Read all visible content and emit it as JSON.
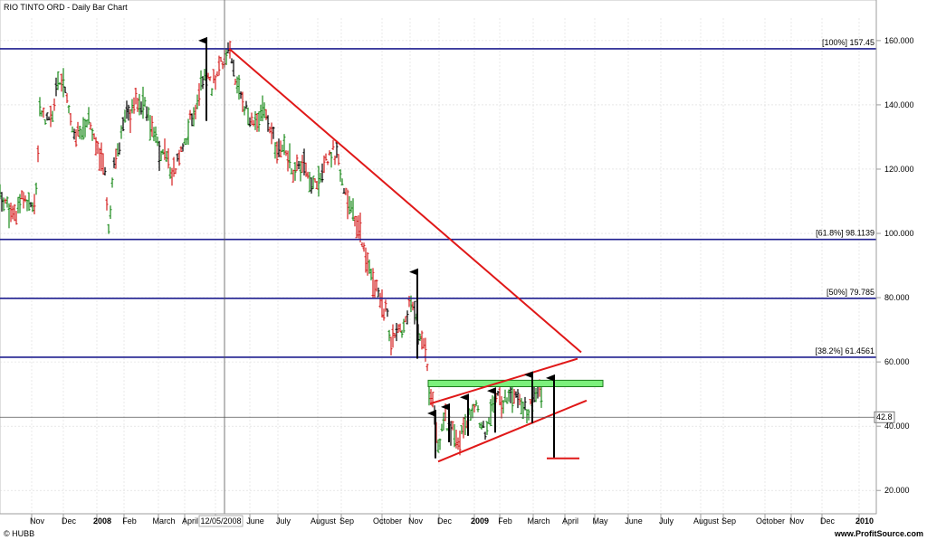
{
  "chart_data": {
    "type": "bar",
    "title": "RIO TINTO ORD - Daily Bar Chart",
    "ylim": [
      15,
      167
    ],
    "y_ticks": [
      20,
      40,
      60,
      80,
      100,
      120,
      140,
      160
    ],
    "y_tick_labels": [
      "20.000",
      "40.000",
      "60.000",
      "80.000",
      "100.000",
      "120.000",
      "140.000",
      "160.000"
    ],
    "x_labels": [
      "Nov",
      "Dec",
      "2008",
      "Feb",
      "March",
      "April",
      "12/05/2008",
      "June",
      "July",
      "August",
      "Sep",
      "October",
      "Nov",
      "Dec",
      "2009",
      "Feb",
      "March",
      "April",
      "May",
      "June",
      "July",
      "August",
      "Sep",
      "October",
      "Nov",
      "Dec",
      "2010"
    ],
    "current_price": "42.8",
    "fib_levels": [
      {
        "label": "[100%] 157.45",
        "value": 157.45
      },
      {
        "label": "[61.8%] 98.1139",
        "value": 98.1139
      },
      {
        "label": "[50%] 79.785",
        "value": 79.785
      },
      {
        "label": "[38.2%] 61.4561",
        "value": 61.4561
      }
    ],
    "price_path": [
      [
        0,
        112
      ],
      [
        8,
        108
      ],
      [
        16,
        106
      ],
      [
        24,
        110
      ],
      [
        34,
        108
      ],
      [
        40,
        112
      ],
      [
        44,
        140
      ],
      [
        50,
        136
      ],
      [
        56,
        134
      ],
      [
        62,
        146
      ],
      [
        70,
        148
      ],
      [
        80,
        132
      ],
      [
        88,
        130
      ],
      [
        96,
        136
      ],
      [
        104,
        130
      ],
      [
        110,
        124
      ],
      [
        116,
        118
      ],
      [
        120,
        100
      ],
      [
        126,
        120
      ],
      [
        132,
        128
      ],
      [
        138,
        138
      ],
      [
        144,
        136
      ],
      [
        150,
        142
      ],
      [
        156,
        140
      ],
      [
        162,
        138
      ],
      [
        170,
        130
      ],
      [
        176,
        126
      ],
      [
        182,
        126
      ],
      [
        190,
        118
      ],
      [
        196,
        122
      ],
      [
        202,
        126
      ],
      [
        206,
        130
      ],
      [
        210,
        136
      ],
      [
        216,
        138
      ],
      [
        222,
        146
      ],
      [
        228,
        150
      ],
      [
        234,
        146
      ],
      [
        240,
        150
      ],
      [
        246,
        154
      ],
      [
        252,
        158
      ],
      [
        258,
        150
      ],
      [
        262,
        146
      ],
      [
        268,
        140
      ],
      [
        276,
        136
      ],
      [
        282,
        134
      ],
      [
        288,
        138
      ],
      [
        294,
        136
      ],
      [
        300,
        132
      ],
      [
        306,
        126
      ],
      [
        312,
        126
      ],
      [
        318,
        124
      ],
      [
        324,
        120
      ],
      [
        330,
        122
      ],
      [
        336,
        120
      ],
      [
        342,
        116
      ],
      [
        350,
        114
      ],
      [
        356,
        118
      ],
      [
        362,
        124
      ],
      [
        368,
        126
      ],
      [
        374,
        122
      ],
      [
        380,
        114
      ],
      [
        386,
        108
      ],
      [
        392,
        104
      ],
      [
        398,
        100
      ],
      [
        404,
        92
      ],
      [
        410,
        86
      ],
      [
        416,
        82
      ],
      [
        422,
        78
      ],
      [
        428,
        74
      ],
      [
        432,
        66
      ],
      [
        436,
        70
      ],
      [
        440,
        72
      ],
      [
        444,
        68
      ],
      [
        448,
        72
      ],
      [
        452,
        80
      ],
      [
        458,
        74
      ],
      [
        462,
        70
      ],
      [
        466,
        66
      ],
      [
        470,
        64
      ],
      [
        474,
        52
      ],
      [
        478,
        46
      ],
      [
        482,
        38
      ],
      [
        486,
        34
      ],
      [
        490,
        42
      ],
      [
        496,
        40
      ],
      [
        502,
        38
      ],
      [
        508,
        36
      ],
      [
        514,
        40
      ],
      [
        520,
        44
      ],
      [
        526,
        48
      ],
      [
        530,
        40
      ],
      [
        536,
        38
      ],
      [
        542,
        44
      ],
      [
        548,
        50
      ],
      [
        554,
        46
      ],
      [
        560,
        48
      ],
      [
        566,
        50
      ],
      [
        572,
        48
      ],
      [
        578,
        46
      ],
      [
        584,
        44
      ],
      [
        588,
        48
      ],
      [
        594,
        52
      ],
      [
        600,
        50
      ]
    ],
    "annotations": {
      "resistance_line": [
        [
          253,
          157.5
        ],
        [
          642,
          63
        ]
      ],
      "channel_upper": [
        [
          475,
          47
        ],
        [
          638,
          61
        ]
      ],
      "channel_lower": [
        [
          484,
          29
        ],
        [
          648,
          48
        ]
      ],
      "green_zone": [
        52.3,
        54.3
      ],
      "green_zone_x": [
        473,
        666
      ],
      "cross_x": 248,
      "arrows": [
        {
          "x": 228,
          "from": 135,
          "to": 160
        },
        {
          "x": 461,
          "from": 61,
          "to": 88
        },
        {
          "x": 481,
          "from": 30,
          "to": 44
        },
        {
          "x": 496,
          "from": 35,
          "to": 46
        },
        {
          "x": 517,
          "from": 37,
          "to": 49
        },
        {
          "x": 547,
          "from": 38,
          "to": 51
        },
        {
          "x": 588,
          "from": 41,
          "to": 56
        },
        {
          "x": 612,
          "from": 30,
          "to": 55
        }
      ],
      "target_bar": {
        "x1": 604,
        "x2": 640,
        "y": 30
      }
    }
  },
  "footer": {
    "left": "© HUBB",
    "right": "www.ProfitSource.com"
  }
}
